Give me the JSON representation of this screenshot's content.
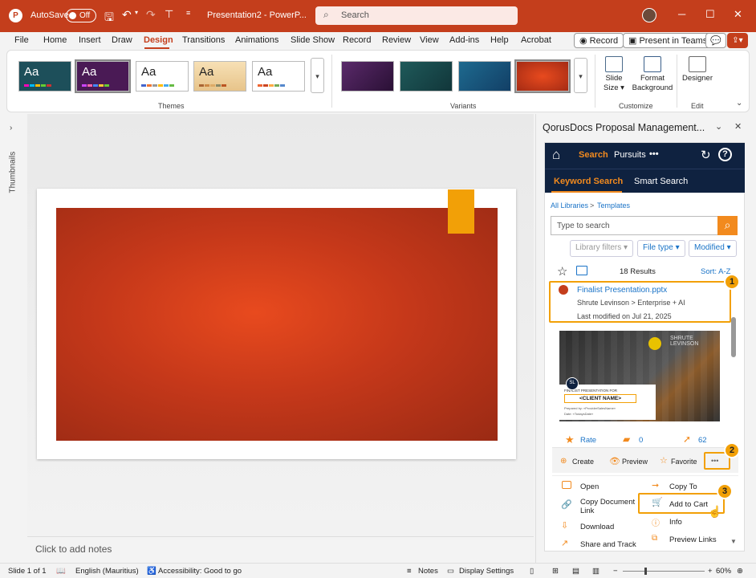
{
  "titlebar": {
    "autosave_label": "AutoSave",
    "autosave_state": "Off",
    "doc_title": "Presentation2 - PowerP...",
    "search_placeholder": "Search"
  },
  "tabs": [
    "File",
    "Home",
    "Insert",
    "Draw",
    "Design",
    "Transitions",
    "Animations",
    "Slide Show",
    "Record",
    "Review",
    "View",
    "Add-ins",
    "Help",
    "Acrobat"
  ],
  "active_tab": "Design",
  "right_buttons": {
    "record": "Record",
    "present": "Present in Teams"
  },
  "ribbon": {
    "themes_label": "Themes",
    "variants_label": "Variants",
    "customize_label": "Customize",
    "edit_label": "Edit",
    "theme_aa": "Aa",
    "slide_size": "Slide\nSize",
    "format_background": "Format Background",
    "designer": "Designer"
  },
  "left_strip": {
    "thumbnails": "Thumbnails"
  },
  "notes_placeholder": "Click to add notes",
  "panel": {
    "title": "QorusDocs Proposal Management...",
    "nav": {
      "search": "Search",
      "pursuits": "Pursuits",
      "more": "•••"
    },
    "subnav": {
      "keyword": "Keyword Search",
      "smart": "Smart Search"
    },
    "breadcrumb": {
      "root": "All Libraries",
      "sep": ">",
      "current": "Templates"
    },
    "search_placeholder": "Type to search",
    "filters": {
      "library": "Library filters",
      "filetype": "File type",
      "modified": "Modified"
    },
    "results": {
      "count": "18 Results",
      "sort": "Sort: A-Z"
    },
    "item": {
      "name": "Finalist Presentation.pptx",
      "path": "Shrute Levinson > Enterprise + AI",
      "modified": "Last modified on  Jul 21, 2025",
      "preview_brand": "SHRUTE LEVINSON",
      "preview_small": "FINALIST PRESENTATION FOR",
      "preview_client": "<CLIENT NAME>",
      "preview_prepared": "Prepared by: «ProviderSalesName»",
      "preview_date": "Date: «TodaysDate»",
      "preview_logo": "SL"
    },
    "stats": {
      "rate": "Rate",
      "comments": "0",
      "views": "62"
    },
    "actions": {
      "create": "Create",
      "preview": "Preview",
      "favorite": "Favorite",
      "more": "•••"
    },
    "menu_left": [
      "Open",
      "Copy Document\nLink",
      "Download",
      "Share and Track"
    ],
    "menu_right": [
      "Copy To",
      "Add to Cart",
      "Info",
      "Preview Links"
    ],
    "callouts": [
      "1",
      "2",
      "3"
    ]
  },
  "status": {
    "slide": "Slide 1 of 1",
    "language": "English (Mauritius)",
    "accessibility": "Accessibility: Good to go",
    "notes": "Notes",
    "display": "Display Settings",
    "zoom": "60%",
    "minus": "−",
    "plus": "+"
  },
  "colors": {
    "accent": "#c43e1c",
    "panel_nav": "#0f2240",
    "qd_orange": "#f28a1e",
    "callout": "#f2a007",
    "link": "#1a73c7"
  }
}
